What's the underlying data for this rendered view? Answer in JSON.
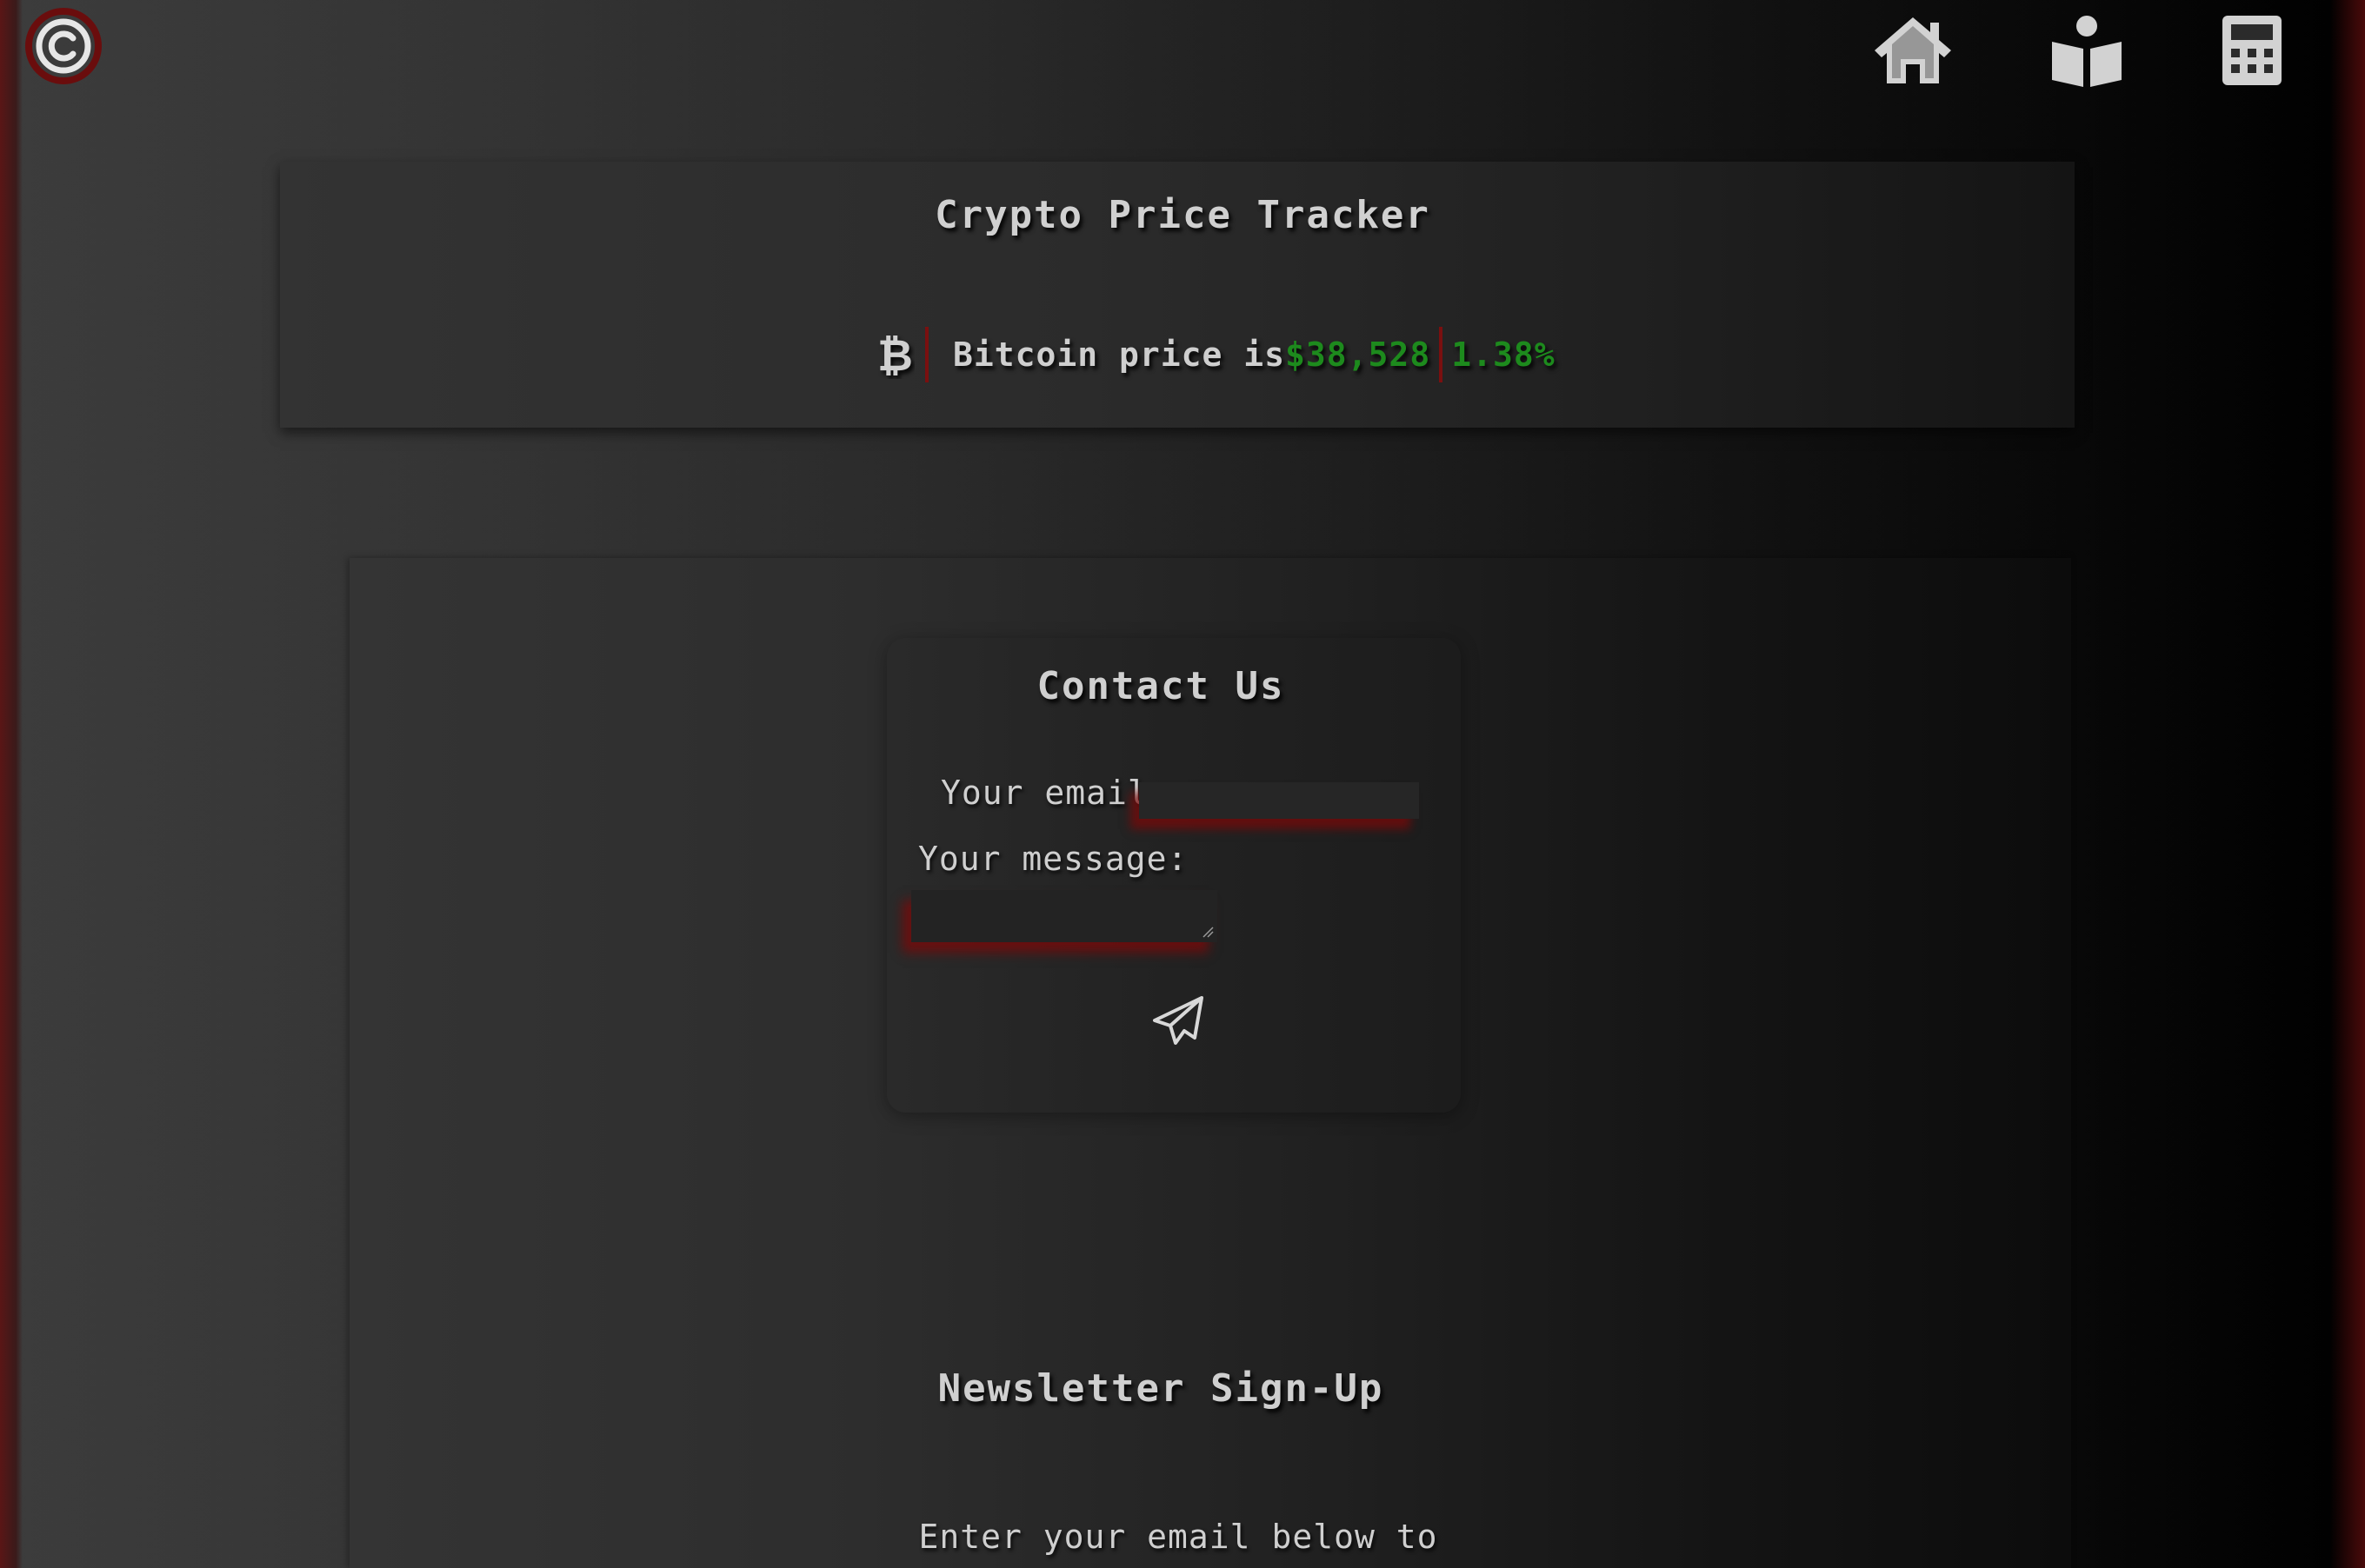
{
  "nav": {
    "logo_icon": "copyright-logo-icon",
    "items": [
      {
        "icon": "home-icon"
      },
      {
        "icon": "book-reader-icon"
      },
      {
        "icon": "calculator-icon"
      }
    ]
  },
  "tracker": {
    "title": "Crypto Price Tracker",
    "coin_icon": "bitcoin-icon",
    "label": "Bitcoin price is",
    "price": "$38,528",
    "change": "1.38%"
  },
  "contact": {
    "title": "Contact Us",
    "email_label": "Your email:",
    "message_label": "Your message:",
    "email_value": "",
    "message_value": "",
    "send_icon": "paper-plane-icon"
  },
  "newsletter": {
    "title": "Newsletter Sign-Up",
    "text": "Enter your email below to join the weekly newsletter"
  },
  "colors": {
    "accent_red": "#7a0f0f",
    "positive_green": "#1d8a1d"
  }
}
